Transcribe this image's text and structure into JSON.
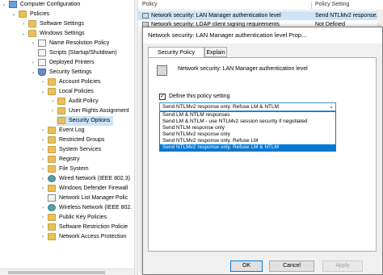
{
  "tree": {
    "nodes": [
      {
        "label": "Computer Configuration",
        "icon": "computer-icon"
      },
      {
        "label": "Policies",
        "icon": "folder-icon"
      },
      {
        "label": "Software Settings",
        "icon": "folder-icon"
      },
      {
        "label": "Windows Settings",
        "icon": "folder-icon"
      },
      {
        "label": "Name Resolution Policy",
        "icon": "document-icon"
      },
      {
        "label": "Scripts (Startup/Shutdown)",
        "icon": "document-icon"
      },
      {
        "label": "Deployed Printers",
        "icon": "printer-icon"
      },
      {
        "label": "Security Settings",
        "icon": "shield-icon"
      },
      {
        "label": "Account Policies",
        "icon": "folder-icon"
      },
      {
        "label": "Local Policies",
        "icon": "folder-icon"
      },
      {
        "label": "Audit Policy",
        "icon": "folder-icon"
      },
      {
        "label": "User Rights Assignment",
        "icon": "folder-icon"
      },
      {
        "label": "Security Options",
        "icon": "folder-icon"
      },
      {
        "label": "Event Log",
        "icon": "folder-icon"
      },
      {
        "label": "Restricted Groups",
        "icon": "folder-icon"
      },
      {
        "label": "System Services",
        "icon": "folder-icon"
      },
      {
        "label": "Registry",
        "icon": "folder-icon"
      },
      {
        "label": "File System",
        "icon": "folder-icon"
      },
      {
        "label": "Wired Network (IEEE 802.3)",
        "icon": "network-icon"
      },
      {
        "label": "Windows Defender Firewall",
        "icon": "folder-icon"
      },
      {
        "label": "Network List Manager Polic",
        "icon": "document-icon"
      },
      {
        "label": "Wireless Network (IEEE 802.",
        "icon": "network-icon"
      },
      {
        "label": "Public Key Policies",
        "icon": "folder-icon"
      },
      {
        "label": "Software Restriction Policie",
        "icon": "folder-icon"
      },
      {
        "label": "Network Access Protection",
        "icon": "folder-icon"
      }
    ]
  },
  "list": {
    "columns": [
      "Policy",
      "Policy Setting"
    ],
    "rows": [
      {
        "policy": "Network security: LAN Manager authentication level",
        "setting": "Send NTLMv2 response..."
      },
      {
        "policy": "Network security: LDAP client signing requirements",
        "setting": "Not Defined"
      }
    ]
  },
  "dialog": {
    "title": "Network security: LAN Manager authentication level Prop...",
    "tabs": [
      "Security Policy Setting",
      "Explain"
    ],
    "policy_name": "Network security: LAN Manager authentication level",
    "define_label": "Define this policy setting",
    "define_checked": "✓",
    "selected_value": "Send NTLMv2 response only. Refuse LM & NTLM",
    "options": [
      "Send LM & NTLM responses",
      "Send LM & NTLM - use NTLMv2 session security if negotiated",
      "Send NTLM response only",
      "Send NTLMv2 response only",
      "Send NTLMv2 response only. Refuse LM",
      "Send NTLMv2 response only. Refuse LM & NTLM"
    ],
    "buttons": {
      "ok": "OK",
      "cancel": "Cancel",
      "apply": "Apply"
    }
  },
  "colors": {
    "accent": "#0078d7",
    "selection": "#cce4f7",
    "warning": "#f4c010"
  }
}
